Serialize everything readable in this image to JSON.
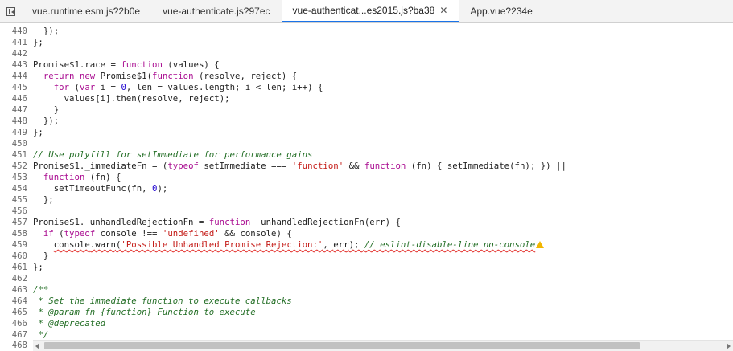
{
  "tabs": [
    {
      "label": "vue.runtime.esm.js?2b0e",
      "active": false
    },
    {
      "label": "vue-authenticate.js?97ec",
      "active": false
    },
    {
      "label": "vue-authenticat...es2015.js?ba38",
      "active": true,
      "closable": true
    },
    {
      "label": "App.vue?234e",
      "active": false
    }
  ],
  "icons": {
    "panel_toggle": "panel-toggle-icon",
    "close": "close-icon",
    "warning": "warning-icon"
  },
  "colors": {
    "keyword": "#aa0d91",
    "string": "#c41a16",
    "number": "#1c00cf",
    "comment": "#236e25",
    "active_tab_underline": "#1a73e8",
    "warning": "#f2b600"
  },
  "editor": {
    "lines": [
      {
        "n": "440",
        "code": "  });"
      },
      {
        "n": "441",
        "code": "};"
      },
      {
        "n": "442",
        "code": ""
      },
      {
        "n": "443",
        "code": "Promise$1.race = function (values) {"
      },
      {
        "n": "444",
        "code": "  return new Promise$1(function (resolve, reject) {"
      },
      {
        "n": "445",
        "code": "    for (var i = 0, len = values.length; i < len; i++) {"
      },
      {
        "n": "446",
        "code": "      values[i].then(resolve, reject);"
      },
      {
        "n": "447",
        "code": "    }"
      },
      {
        "n": "448",
        "code": "  });"
      },
      {
        "n": "449",
        "code": "};"
      },
      {
        "n": "450",
        "code": ""
      },
      {
        "n": "451",
        "code": "// Use polyfill for setImmediate for performance gains"
      },
      {
        "n": "452",
        "code": "Promise$1._immediateFn = (typeof setImmediate === 'function' && function (fn) { setImmediate(fn); }) ||"
      },
      {
        "n": "453",
        "code": "  function (fn) {"
      },
      {
        "n": "454",
        "code": "    setTimeoutFunc(fn, 0);"
      },
      {
        "n": "455",
        "code": "  };"
      },
      {
        "n": "456",
        "code": ""
      },
      {
        "n": "457",
        "code": "Promise$1._unhandledRejectionFn = function _unhandledRejectionFn(err) {"
      },
      {
        "n": "458",
        "code": "  if (typeof console !== 'undefined' && console) {"
      },
      {
        "n": "459",
        "code": "    console.warn('Possible Unhandled Promise Rejection:', err); // eslint-disable-line no-console",
        "warning": true
      },
      {
        "n": "460",
        "code": "  }"
      },
      {
        "n": "461",
        "code": "};"
      },
      {
        "n": "462",
        "code": ""
      },
      {
        "n": "463",
        "code": "/**"
      },
      {
        "n": "464",
        "code": " * Set the immediate function to execute callbacks"
      },
      {
        "n": "465",
        "code": " * @param fn {function} Function to execute"
      },
      {
        "n": "466",
        "code": " * @deprecated"
      },
      {
        "n": "467",
        "code": " */"
      }
    ],
    "last_line_number": "468"
  }
}
